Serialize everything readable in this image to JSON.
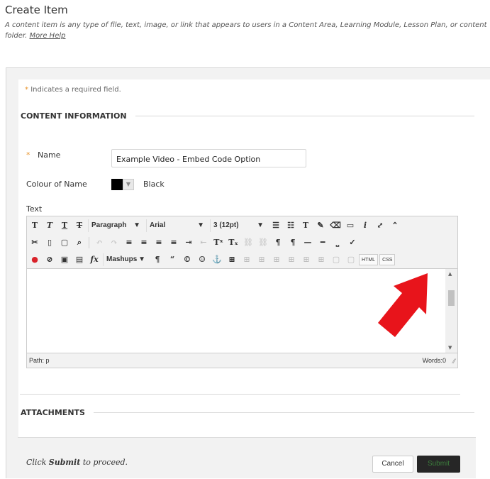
{
  "header": {
    "title": "Create Item",
    "description": "A content item is any type of file, text, image, or link that appears to users in a Content Area, Learning Module, Lesson Plan, or content folder.",
    "more_help": "More Help"
  },
  "form": {
    "required_star": "*",
    "required_note": "Indicates a required field.",
    "content_section": "CONTENT INFORMATION",
    "name_label": "Name",
    "name_value": "Example Video - Embed Code Option",
    "colour_label": "Colour of Name",
    "colour_value": "Black",
    "text_label": "Text",
    "attachments_section": "ATTACHMENTS"
  },
  "editor": {
    "format_select": "Paragraph",
    "font_select": "Arial",
    "size_select": "3 (12pt)",
    "mashups_label": "Mashups",
    "html_button": "HTML",
    "css_button": "CSS",
    "path_label": "Path: p",
    "words_label": "Words:0"
  },
  "submit": {
    "prompt_prefix": "Click",
    "prompt_bold": "Submit",
    "prompt_suffix": "to proceed.",
    "cancel_label": "Cancel",
    "submit_label": "Submit"
  },
  "colors": {
    "required_star": "#e8932a",
    "arrow": "#e8141b",
    "submit_bg": "#262626"
  }
}
